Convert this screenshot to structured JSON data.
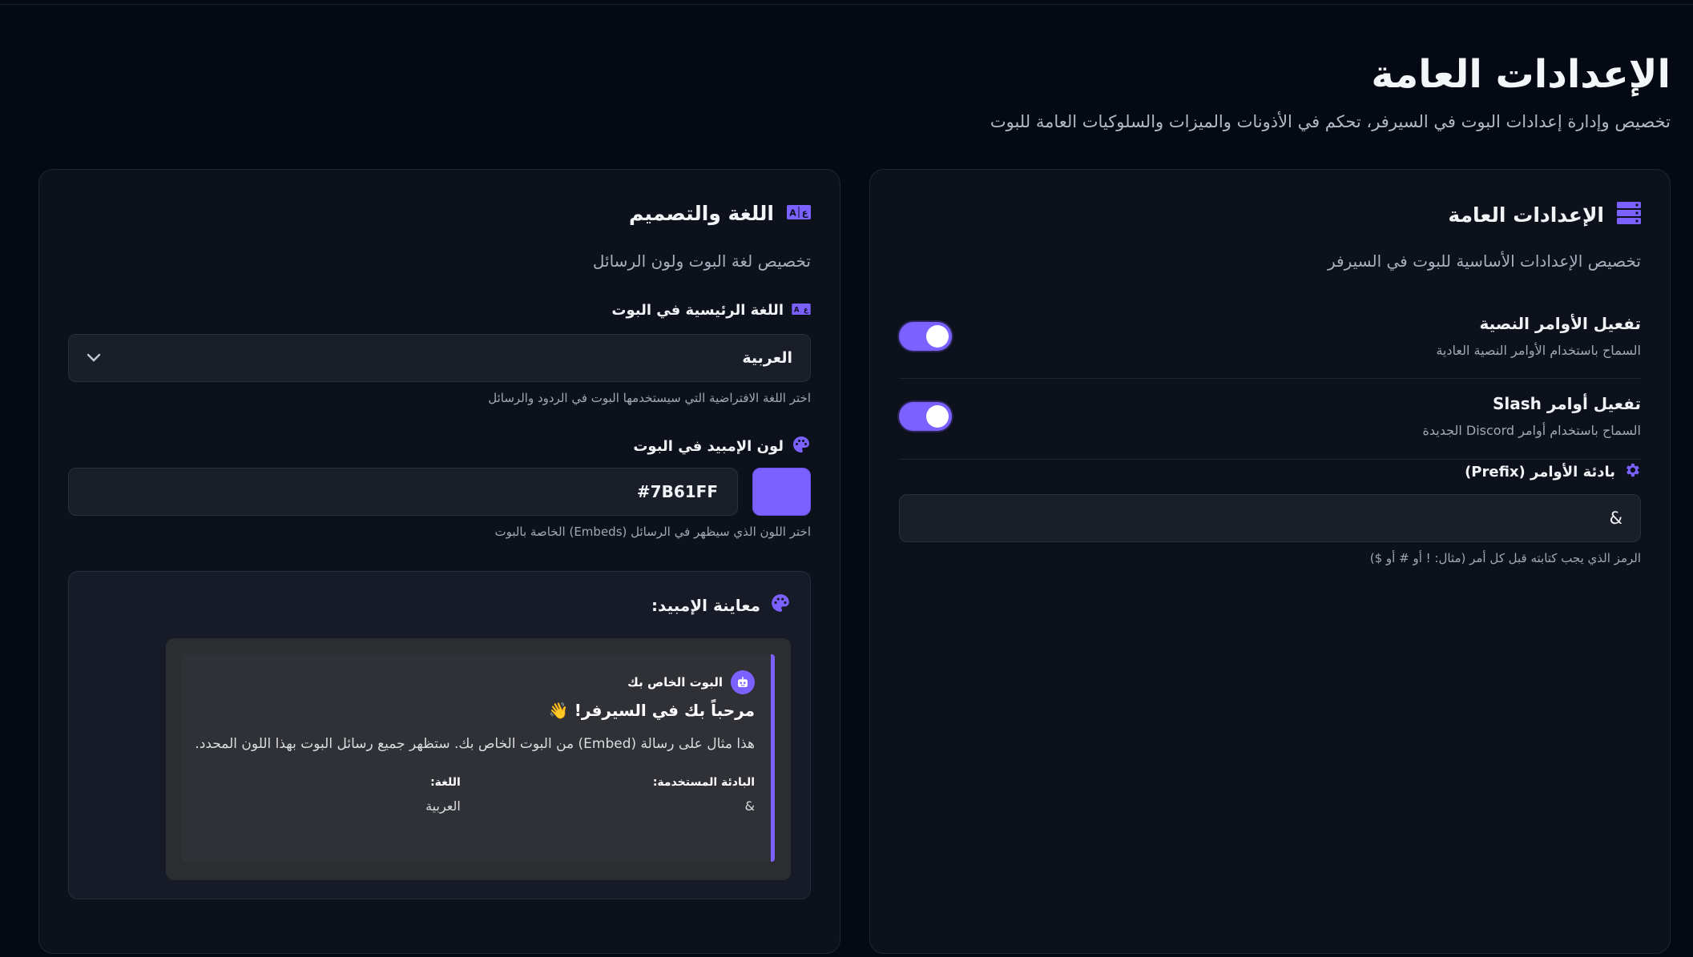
{
  "page": {
    "title": "الإعدادات العامة",
    "subtitle": "تخصيص وإدارة إعدادات البوت في السيرفر، تحكم في الأذونات والميزات والسلوكيات العامة للبوت"
  },
  "general_card": {
    "title": "الإعدادات العامة",
    "subtitle": "تخصيص الإعدادات الأساسية للبوت في السيرفر",
    "text_commands": {
      "title": "تفعيل الأوامر النصية",
      "desc": "السماح باستخدام الأوامر النصية العادية",
      "enabled": true
    },
    "slash_commands": {
      "title": "تفعيل أوامر Slash",
      "desc": "السماح باستخدام أوامر Discord الجديدة",
      "enabled": true
    },
    "prefix": {
      "label": "بادئة الأوامر (Prefix)",
      "value": "&",
      "help": "الرمز الذي يجب كتابته قبل كل أمر (مثال: ! أو # أو $)"
    }
  },
  "design_card": {
    "title": "اللغة والتصميم",
    "subtitle": "تخصيص لغة البوت ولون الرسائل",
    "language": {
      "label": "اللغة الرئيسية في البوت",
      "value": "العربية",
      "help": "اختر اللغة الافتراضية التي سيستخدمها البوت في الردود والرسائل"
    },
    "embed_color": {
      "label": "لون الإمبيد في البوت",
      "value": "#7B61FF",
      "help": "اختر اللون الذي سيظهر في الرسائل (Embeds) الخاصة بالبوت"
    },
    "preview": {
      "title": "معاينة الإمبيد:",
      "author": "البوت الخاص بك",
      "embed_title": "مرحباً بك في السيرفر! 👋",
      "embed_desc": "هذا مثال على رسالة (Embed) من البوت الخاص بك. ستظهر جميع رسائل البوت بهذا اللون المحدد.",
      "field1_name": "البادئة المستخدمة:",
      "field1_value": "&",
      "field2_name": "اللغة:",
      "field2_value": "العربية"
    }
  },
  "colors": {
    "accent": "#7B61FF",
    "background": "#050914",
    "card": "#0D111C"
  },
  "icons": {
    "general": "server-icon",
    "design": "translate-icon",
    "prefix": "gear-icon",
    "color": "palette-icon",
    "preview": "palette-icon",
    "avatar": "robot-icon"
  }
}
